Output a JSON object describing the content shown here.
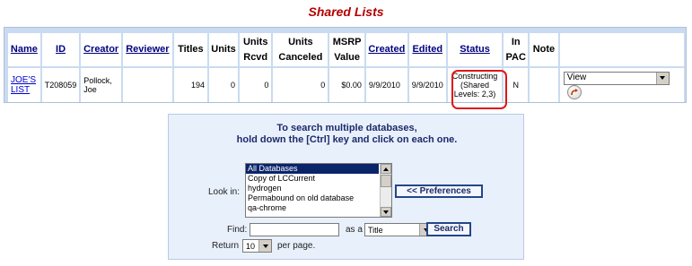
{
  "page": {
    "title": "Shared Lists"
  },
  "lists_table": {
    "headers": [
      {
        "line1": "Name",
        "link": true
      },
      {
        "line1": "ID",
        "link": true
      },
      {
        "line1": "Creator",
        "link": true
      },
      {
        "line1": "Reviewer",
        "link": true
      },
      {
        "line1": "Titles",
        "link": false
      },
      {
        "line1": "Units",
        "link": false
      },
      {
        "line1": "Units",
        "line2": "Rcvd",
        "link": false
      },
      {
        "line1": "Units",
        "line2": "Canceled",
        "link": false
      },
      {
        "line1": "MSRP",
        "line2": "Value",
        "link": false
      },
      {
        "line1": "Created",
        "link": true
      },
      {
        "line1": "Edited",
        "link": true
      },
      {
        "line1": "Status",
        "link": true
      },
      {
        "line1": "In",
        "line2": "PAC",
        "link": false
      },
      {
        "line1": "Note",
        "link": false
      }
    ],
    "row": {
      "name_line1": "JOE'S",
      "name_line2": "LIST",
      "id": "T208059",
      "creator_line1": "Pollock,",
      "creator_line2": "Joe",
      "reviewer": "",
      "titles": "194",
      "units": "0",
      "units_rcvd": "0",
      "units_canceled": "0",
      "msrp_value": "$0.00",
      "created": "9/9/2010",
      "edited": "9/9/2010",
      "status_line1": "Constructing",
      "status_line2": "(Shared",
      "status_line3": "Levels: 2,3)",
      "in_pac": "N",
      "note": "",
      "action_value": "View"
    }
  },
  "search": {
    "instructions_line1": "To search multiple databases,",
    "instructions_line2": "hold down the [Ctrl] key and click on each one.",
    "look_in_label": "Look in:",
    "databases": [
      "All Databases",
      "Copy of LCCurrent",
      "hydrogen",
      "Permabound on old database",
      "qa-chrome"
    ],
    "preferences_button": "<< Preferences",
    "find_label": "Find:",
    "find_value": "",
    "as_a_label": "as a",
    "field_value": "Title",
    "search_button": "Search",
    "return_label": "Return",
    "per_page_value": "10",
    "per_page_label": "per page."
  },
  "colors": {
    "title": "#b30000",
    "status_highlight": "#e01515",
    "panel_bg": "#e8f0fc",
    "button_border": "#23468a"
  },
  "icons": {
    "go": "arrow-right-circle-icon"
  }
}
